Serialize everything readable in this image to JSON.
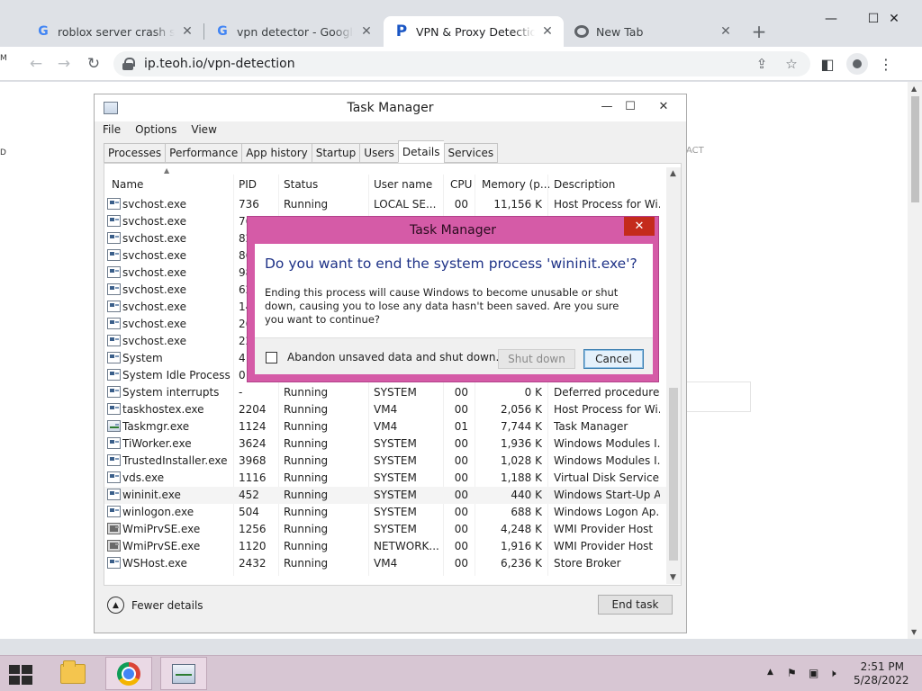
{
  "browser": {
    "tabs": [
      {
        "title": "roblox server crash script",
        "favicon": "google-g-icon",
        "active": false
      },
      {
        "title": "vpn detector - Google Search",
        "favicon": "google-g-icon",
        "active": false
      },
      {
        "title": "VPN & Proxy Detection Tool",
        "favicon": "p-logo-icon",
        "active": true
      },
      {
        "title": "New Tab",
        "favicon": "chrome-icon",
        "active": false
      }
    ],
    "url": "ip.teoh.io/vpn-detection",
    "page_fragment_text": "ACT",
    "desktop_edge_letters": [
      "M",
      "D"
    ]
  },
  "task_manager": {
    "title": "Task Manager",
    "menu": [
      "File",
      "Options",
      "View"
    ],
    "tabs": [
      "Processes",
      "Performance",
      "App history",
      "Startup",
      "Users",
      "Details",
      "Services"
    ],
    "selected_tab": "Details",
    "columns": [
      "Name",
      "PID",
      "Status",
      "User name",
      "CPU",
      "Memory (p...",
      "Description"
    ],
    "rows": [
      {
        "name": "svchost.exe",
        "pid": "736",
        "status": "Running",
        "user": "LOCAL SE...",
        "cpu": "00",
        "mem": "11,156 K",
        "desc": "Host Process for Wi..."
      },
      {
        "name": "svchost.exe",
        "pid": "76",
        "status": "",
        "user": "",
        "cpu": "",
        "mem": "",
        "desc": ""
      },
      {
        "name": "svchost.exe",
        "pid": "82",
        "status": "",
        "user": "",
        "cpu": "",
        "mem": "",
        "desc": ""
      },
      {
        "name": "svchost.exe",
        "pid": "86",
        "status": "",
        "user": "",
        "cpu": "",
        "mem": "",
        "desc": ""
      },
      {
        "name": "svchost.exe",
        "pid": "98",
        "status": "",
        "user": "",
        "cpu": "",
        "mem": "",
        "desc": ""
      },
      {
        "name": "svchost.exe",
        "pid": "62",
        "status": "",
        "user": "",
        "cpu": "",
        "mem": "",
        "desc": ""
      },
      {
        "name": "svchost.exe",
        "pid": "14",
        "status": "",
        "user": "",
        "cpu": "",
        "mem": "",
        "desc": ""
      },
      {
        "name": "svchost.exe",
        "pid": "26",
        "status": "",
        "user": "",
        "cpu": "",
        "mem": "",
        "desc": ""
      },
      {
        "name": "svchost.exe",
        "pid": "22",
        "status": "",
        "user": "",
        "cpu": "",
        "mem": "",
        "desc": ""
      },
      {
        "name": "System",
        "pid": "4",
        "status": "",
        "user": "",
        "cpu": "",
        "mem": "",
        "desc": ""
      },
      {
        "name": "System Idle Process",
        "pid": "0",
        "status": "",
        "user": "",
        "cpu": "",
        "mem": "",
        "desc": ""
      },
      {
        "name": "System interrupts",
        "pid": "-",
        "status": "Running",
        "user": "SYSTEM",
        "cpu": "00",
        "mem": "0 K",
        "desc": "Deferred procedure ..."
      },
      {
        "name": "taskhostex.exe",
        "pid": "2204",
        "status": "Running",
        "user": "VM4",
        "cpu": "00",
        "mem": "2,056 K",
        "desc": "Host Process for Wi..."
      },
      {
        "name": "Taskmgr.exe",
        "pid": "1124",
        "status": "Running",
        "user": "VM4",
        "cpu": "01",
        "mem": "7,744 K",
        "desc": "Task Manager"
      },
      {
        "name": "TiWorker.exe",
        "pid": "3624",
        "status": "Running",
        "user": "SYSTEM",
        "cpu": "00",
        "mem": "1,936 K",
        "desc": "Windows Modules I..."
      },
      {
        "name": "TrustedInstaller.exe",
        "pid": "3968",
        "status": "Running",
        "user": "SYSTEM",
        "cpu": "00",
        "mem": "1,028 K",
        "desc": "Windows Modules I..."
      },
      {
        "name": "vds.exe",
        "pid": "1116",
        "status": "Running",
        "user": "SYSTEM",
        "cpu": "00",
        "mem": "1,188 K",
        "desc": "Virtual Disk Service"
      },
      {
        "name": "wininit.exe",
        "pid": "452",
        "status": "Running",
        "user": "SYSTEM",
        "cpu": "00",
        "mem": "440 K",
        "desc": "Windows Start-Up A..."
      },
      {
        "name": "winlogon.exe",
        "pid": "504",
        "status": "Running",
        "user": "SYSTEM",
        "cpu": "00",
        "mem": "688 K",
        "desc": "Windows Logon Ap..."
      },
      {
        "name": "WmiPrvSE.exe",
        "pid": "1256",
        "status": "Running",
        "user": "SYSTEM",
        "cpu": "00",
        "mem": "4,248 K",
        "desc": "WMI Provider Host"
      },
      {
        "name": "WmiPrvSE.exe",
        "pid": "1120",
        "status": "Running",
        "user": "NETWORK...",
        "cpu": "00",
        "mem": "1,916 K",
        "desc": "WMI Provider Host"
      },
      {
        "name": "WSHost.exe",
        "pid": "2432",
        "status": "Running",
        "user": "VM4",
        "cpu": "00",
        "mem": "6,236 K",
        "desc": "Store Broker"
      }
    ],
    "fewer_details": "Fewer details",
    "end_task": "End task"
  },
  "dialog": {
    "title": "Task Manager",
    "question": "Do you want to end the system process 'wininit.exe'?",
    "body": "Ending this process will cause Windows to become unusable or shut down, causing you to lose any data hasn't been saved. Are you sure you want to continue?",
    "checkbox_label": "Abandon unsaved data and shut down.",
    "checkbox_checked": false,
    "shutdown_button": "Shut down",
    "cancel_button": "Cancel"
  },
  "taskbar": {
    "clock_time": "2:51 PM",
    "clock_date": "5/28/2022"
  },
  "colors": {
    "dialog_frame": "#d55ba7",
    "desktop": "#e6cde0",
    "taskbar": "#d7c6d3",
    "dialog_heading": "#1e3287"
  }
}
